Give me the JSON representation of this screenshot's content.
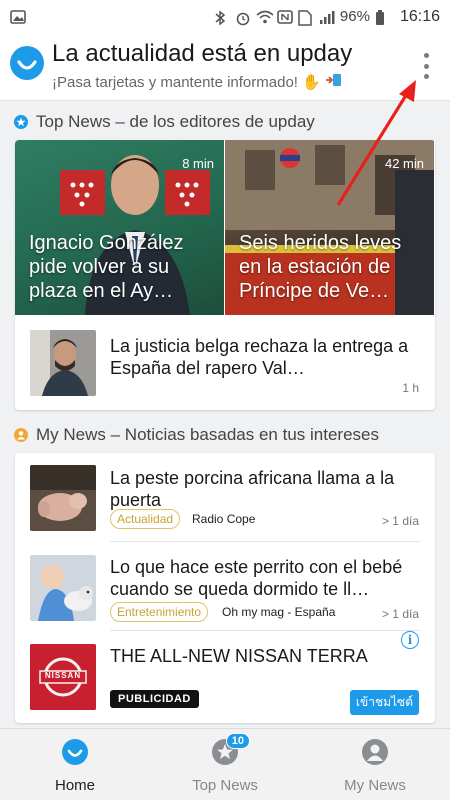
{
  "statusbar": {
    "battery": "96%",
    "time": "16:16",
    "icons": [
      "image-icon",
      "bluetooth-icon",
      "alarm-icon",
      "wifi-icon",
      "nfc-icon",
      "sim-icon",
      "signal-icon",
      "battery-icon"
    ]
  },
  "header": {
    "title": "La actualidad está en upday",
    "subtitle": "¡Pasa tarjetas y mantente informado!",
    "subtitle_emoji": "✋",
    "accent": "#1e9be8"
  },
  "top_news": {
    "heading": "Top News – de los editores de upday",
    "heroes": [
      {
        "time": "8 min",
        "headline": "Ignacio González pide volver a su plaza en el Ay…"
      },
      {
        "time": "42 min",
        "headline": "Seis heridos leves en la estación de Príncipe de Ve…"
      }
    ],
    "item": {
      "title": "La justicia belga rechaza la entrega a España del rapero Val…",
      "time": "1 h"
    }
  },
  "my_news": {
    "heading": "My News – Noticias basadas en tus intereses",
    "items": [
      {
        "title": "La peste porcina africana llama a la puerta",
        "tag": "Actualidad",
        "source": "Radio Cope",
        "time": "> 1 día"
      },
      {
        "title": "Lo que hace este perrito con el bebé cuando se queda dormido te ll…",
        "tag": "Entretenimiento",
        "source": "Oh my mag - España",
        "time": "> 1 día"
      }
    ],
    "ad": {
      "title": "THE ALL-NEW NISSAN TERRA",
      "label": "PUBLICIDAD",
      "cta": "เข้าชมไซต์",
      "logo_text": "NISSAN",
      "info": "i"
    }
  },
  "bottom_nav": {
    "items": [
      {
        "label": "Home",
        "active": true
      },
      {
        "label": "Top News",
        "badge": "10"
      },
      {
        "label": "My News"
      }
    ]
  }
}
